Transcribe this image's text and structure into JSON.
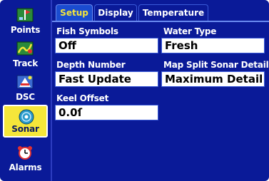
{
  "sidebar": {
    "items": [
      {
        "label": "Points",
        "icon": "points-icon"
      },
      {
        "label": "Track",
        "icon": "track-icon"
      },
      {
        "label": "DSC",
        "icon": "dsc-icon"
      },
      {
        "label": "Sonar",
        "icon": "sonar-icon",
        "selected": true
      },
      {
        "label": "Alarms",
        "icon": "alarm-clock-icon"
      }
    ]
  },
  "tabs": [
    {
      "label": "Setup",
      "active": true
    },
    {
      "label": "Display"
    },
    {
      "label": "Temperature"
    }
  ],
  "fields": {
    "fish_symbols": {
      "label": "Fish Symbols",
      "value": "Off"
    },
    "water_type": {
      "label": "Water Type",
      "value": "Fresh"
    },
    "depth_number": {
      "label": "Depth Number",
      "value": "Fast Update"
    },
    "map_split": {
      "label": "Map Split Sonar Detail",
      "value": "Maximum Detail"
    },
    "keel_offset": {
      "label": "Keel Offset",
      "value": "0.0ſ"
    }
  },
  "colors": {
    "background": "#0a1a98",
    "selected": "#f5e63a",
    "active_tab_text": "#f5e63a",
    "field_bg": "#ffffff"
  }
}
